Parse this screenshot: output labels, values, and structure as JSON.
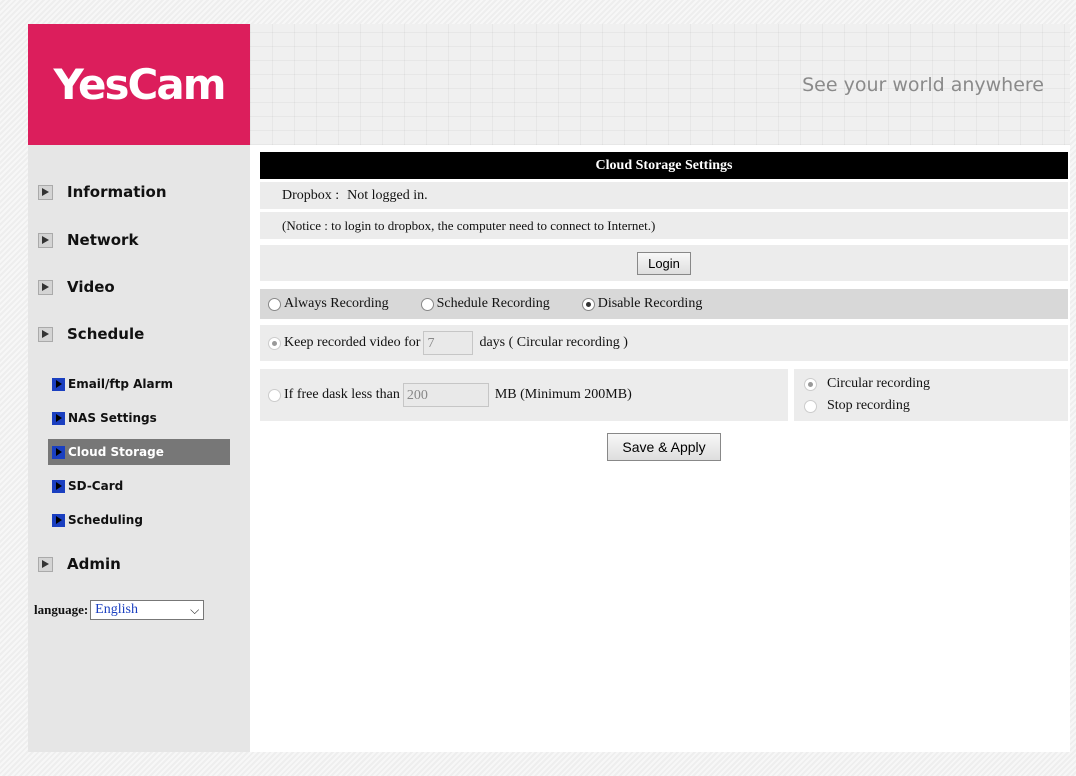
{
  "brand": {
    "logo": "YesCam",
    "tagline": "See your world anywhere",
    "logo_color": "#dc1e5c"
  },
  "sidebar": {
    "menu": [
      {
        "label": "Information",
        "icon": "arrow-right-icon"
      },
      {
        "label": "Network",
        "icon": "arrow-right-icon"
      },
      {
        "label": "Video",
        "icon": "arrow-right-icon"
      },
      {
        "label": "Schedule",
        "icon": "arrow-right-icon"
      }
    ],
    "schedule_sub": [
      {
        "label": "Email/ftp Alarm",
        "icon": "blue-arrow-icon"
      },
      {
        "label": "NAS Settings",
        "icon": "blue-arrow-icon"
      },
      {
        "label": "Cloud Storage",
        "icon": "blue-arrow-icon",
        "active": true
      },
      {
        "label": "SD-Card",
        "icon": "blue-arrow-icon"
      },
      {
        "label": "Scheduling",
        "icon": "blue-arrow-icon"
      }
    ],
    "admin": {
      "label": "Admin",
      "icon": "arrow-right-icon"
    },
    "language": {
      "label": "language:",
      "value": "English"
    }
  },
  "main": {
    "title": "Cloud Storage Settings",
    "dropbox_label": "Dropbox :",
    "dropbox_status": "Not logged in.",
    "notice": "(Notice : to login to dropbox, the computer need to connect to Internet.)",
    "login_button": "Login",
    "recording_modes": [
      {
        "label": "Always Recording",
        "checked": false
      },
      {
        "label": "Schedule Recording",
        "checked": false
      },
      {
        "label": "Disable Recording",
        "checked": true
      }
    ],
    "keep": {
      "prefix": "Keep recorded video for",
      "value": "7",
      "suffix": "days ( Circular recording )",
      "checked": true
    },
    "free_disk": {
      "prefix": "If free dask less than",
      "value": "200",
      "suffix": "MB (Minimum 200MB)",
      "checked": false
    },
    "disk_options": [
      {
        "label": "Circular recording",
        "checked": true
      },
      {
        "label": "Stop recording",
        "checked": false
      }
    ],
    "save_button": "Save & Apply"
  }
}
